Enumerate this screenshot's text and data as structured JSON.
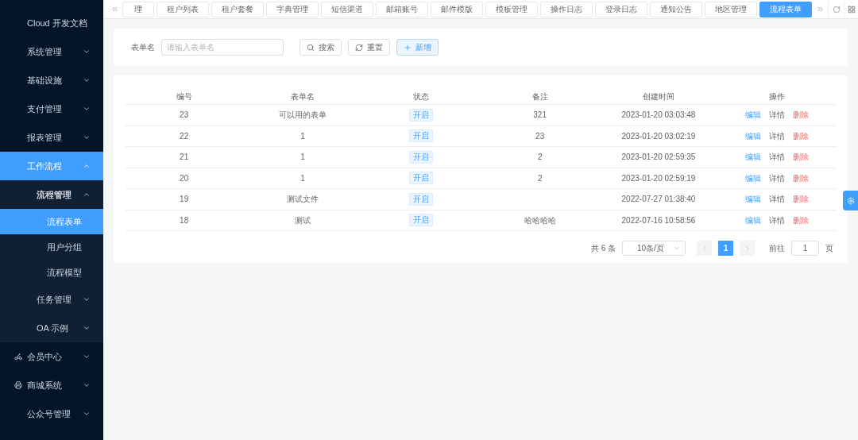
{
  "sidebar": {
    "items": [
      {
        "label": "Cloud 开发文档",
        "kind": "link",
        "selected": false
      },
      {
        "label": "系统管理",
        "kind": "menu",
        "expanded": false,
        "selected": false
      },
      {
        "label": "基础设施",
        "kind": "menu",
        "expanded": false,
        "selected": false
      },
      {
        "label": "支付管理",
        "kind": "menu",
        "expanded": false,
        "selected": false
      },
      {
        "label": "报表管理",
        "kind": "menu",
        "expanded": false,
        "selected": false
      },
      {
        "label": "工作流程",
        "kind": "menu",
        "expanded": true,
        "selected": true,
        "children": [
          {
            "label": "流程管理",
            "kind": "menu",
            "expanded": true,
            "selected": false,
            "children": [
              {
                "label": "流程表单",
                "kind": "link",
                "selected": true
              },
              {
                "label": "用户分组",
                "kind": "link",
                "selected": false
              },
              {
                "label": "流程模型",
                "kind": "link",
                "selected": false
              }
            ]
          },
          {
            "label": "任务管理",
            "kind": "menu",
            "expanded": false,
            "selected": false
          },
          {
            "label": "OA 示例",
            "kind": "menu",
            "expanded": false,
            "selected": false
          }
        ]
      },
      {
        "label": "会员中心",
        "kind": "bike-menu",
        "expanded": false,
        "selected": false
      },
      {
        "label": "商城系统",
        "kind": "shop-menu",
        "expanded": false,
        "selected": false
      },
      {
        "label": "公众号管理",
        "kind": "menu",
        "expanded": false,
        "selected": false
      }
    ]
  },
  "tabs": [
    {
      "label": "理",
      "selected": false
    },
    {
      "label": "租户列表",
      "selected": false
    },
    {
      "label": "租户套餐",
      "selected": false
    },
    {
      "label": "字典管理",
      "selected": false
    },
    {
      "label": "短信渠道",
      "selected": false
    },
    {
      "label": "邮箱账号",
      "selected": false
    },
    {
      "label": "邮件模版",
      "selected": false
    },
    {
      "label": "模板管理",
      "selected": false
    },
    {
      "label": "操作日志",
      "selected": false
    },
    {
      "label": "登录日志",
      "selected": false
    },
    {
      "label": "通知公告",
      "selected": false
    },
    {
      "label": "地区管理",
      "selected": false
    },
    {
      "label": "流程表单",
      "selected": true
    }
  ],
  "search": {
    "label": "表单名",
    "placeholder": "请输入表单名",
    "buttons": [
      {
        "label": "搜索",
        "kind": "search"
      },
      {
        "label": "重置",
        "kind": "reset"
      },
      {
        "label": "新增",
        "kind": "add"
      }
    ]
  },
  "table": {
    "columns": [
      "编号",
      "表单名",
      "状态",
      "备注",
      "创建时间",
      "操作"
    ],
    "rows": [
      {
        "id": "23",
        "name": "可以用的表单",
        "status": "开启",
        "remark": "321",
        "created": "2023-01-20 03:03:48",
        "actions": [
          {
            "label": "编辑",
            "kind": "primary"
          },
          {
            "label": "详情",
            "kind": "info"
          },
          {
            "label": "删除",
            "kind": "danger"
          }
        ]
      },
      {
        "id": "22",
        "name": "1",
        "status": "开启",
        "remark": "23",
        "created": "2023-01-20 03:02:19",
        "actions": [
          {
            "label": "编辑",
            "kind": "primary"
          },
          {
            "label": "详情",
            "kind": "info"
          },
          {
            "label": "删除",
            "kind": "danger"
          }
        ]
      },
      {
        "id": "21",
        "name": "1",
        "status": "开启",
        "remark": "2",
        "created": "2023-01-20 02:59:35",
        "actions": [
          {
            "label": "编辑",
            "kind": "primary"
          },
          {
            "label": "详情",
            "kind": "info"
          },
          {
            "label": "删除",
            "kind": "danger"
          }
        ]
      },
      {
        "id": "20",
        "name": "1",
        "status": "开启",
        "remark": "2",
        "created": "2023-01-20 02:59:19",
        "actions": [
          {
            "label": "编辑",
            "kind": "primary"
          },
          {
            "label": "详情",
            "kind": "info"
          },
          {
            "label": "删除",
            "kind": "danger"
          }
        ]
      },
      {
        "id": "19",
        "name": "测试文件",
        "status": "开启",
        "created": "2022-07-27 01:38:40",
        "actions": [
          {
            "label": "编辑",
            "kind": "primary"
          },
          {
            "label": "详情",
            "kind": "info"
          },
          {
            "label": "删除",
            "kind": "danger"
          }
        ]
      },
      {
        "id": "18",
        "name": "测试",
        "status": "开启",
        "remark": "哈哈哈哈",
        "created": "2022-07-16 10:58:56",
        "actions": [
          {
            "label": "编辑",
            "kind": "primary"
          },
          {
            "label": "详情",
            "kind": "info"
          },
          {
            "label": "删除",
            "kind": "danger"
          }
        ]
      }
    ]
  },
  "pagination": {
    "total": "共 6 条",
    "page_size": "10条/页",
    "pages": [
      {
        "label": "1",
        "selected": true
      }
    ],
    "goto_label": "前往",
    "goto_value": "1",
    "goto_suffix": "页"
  }
}
